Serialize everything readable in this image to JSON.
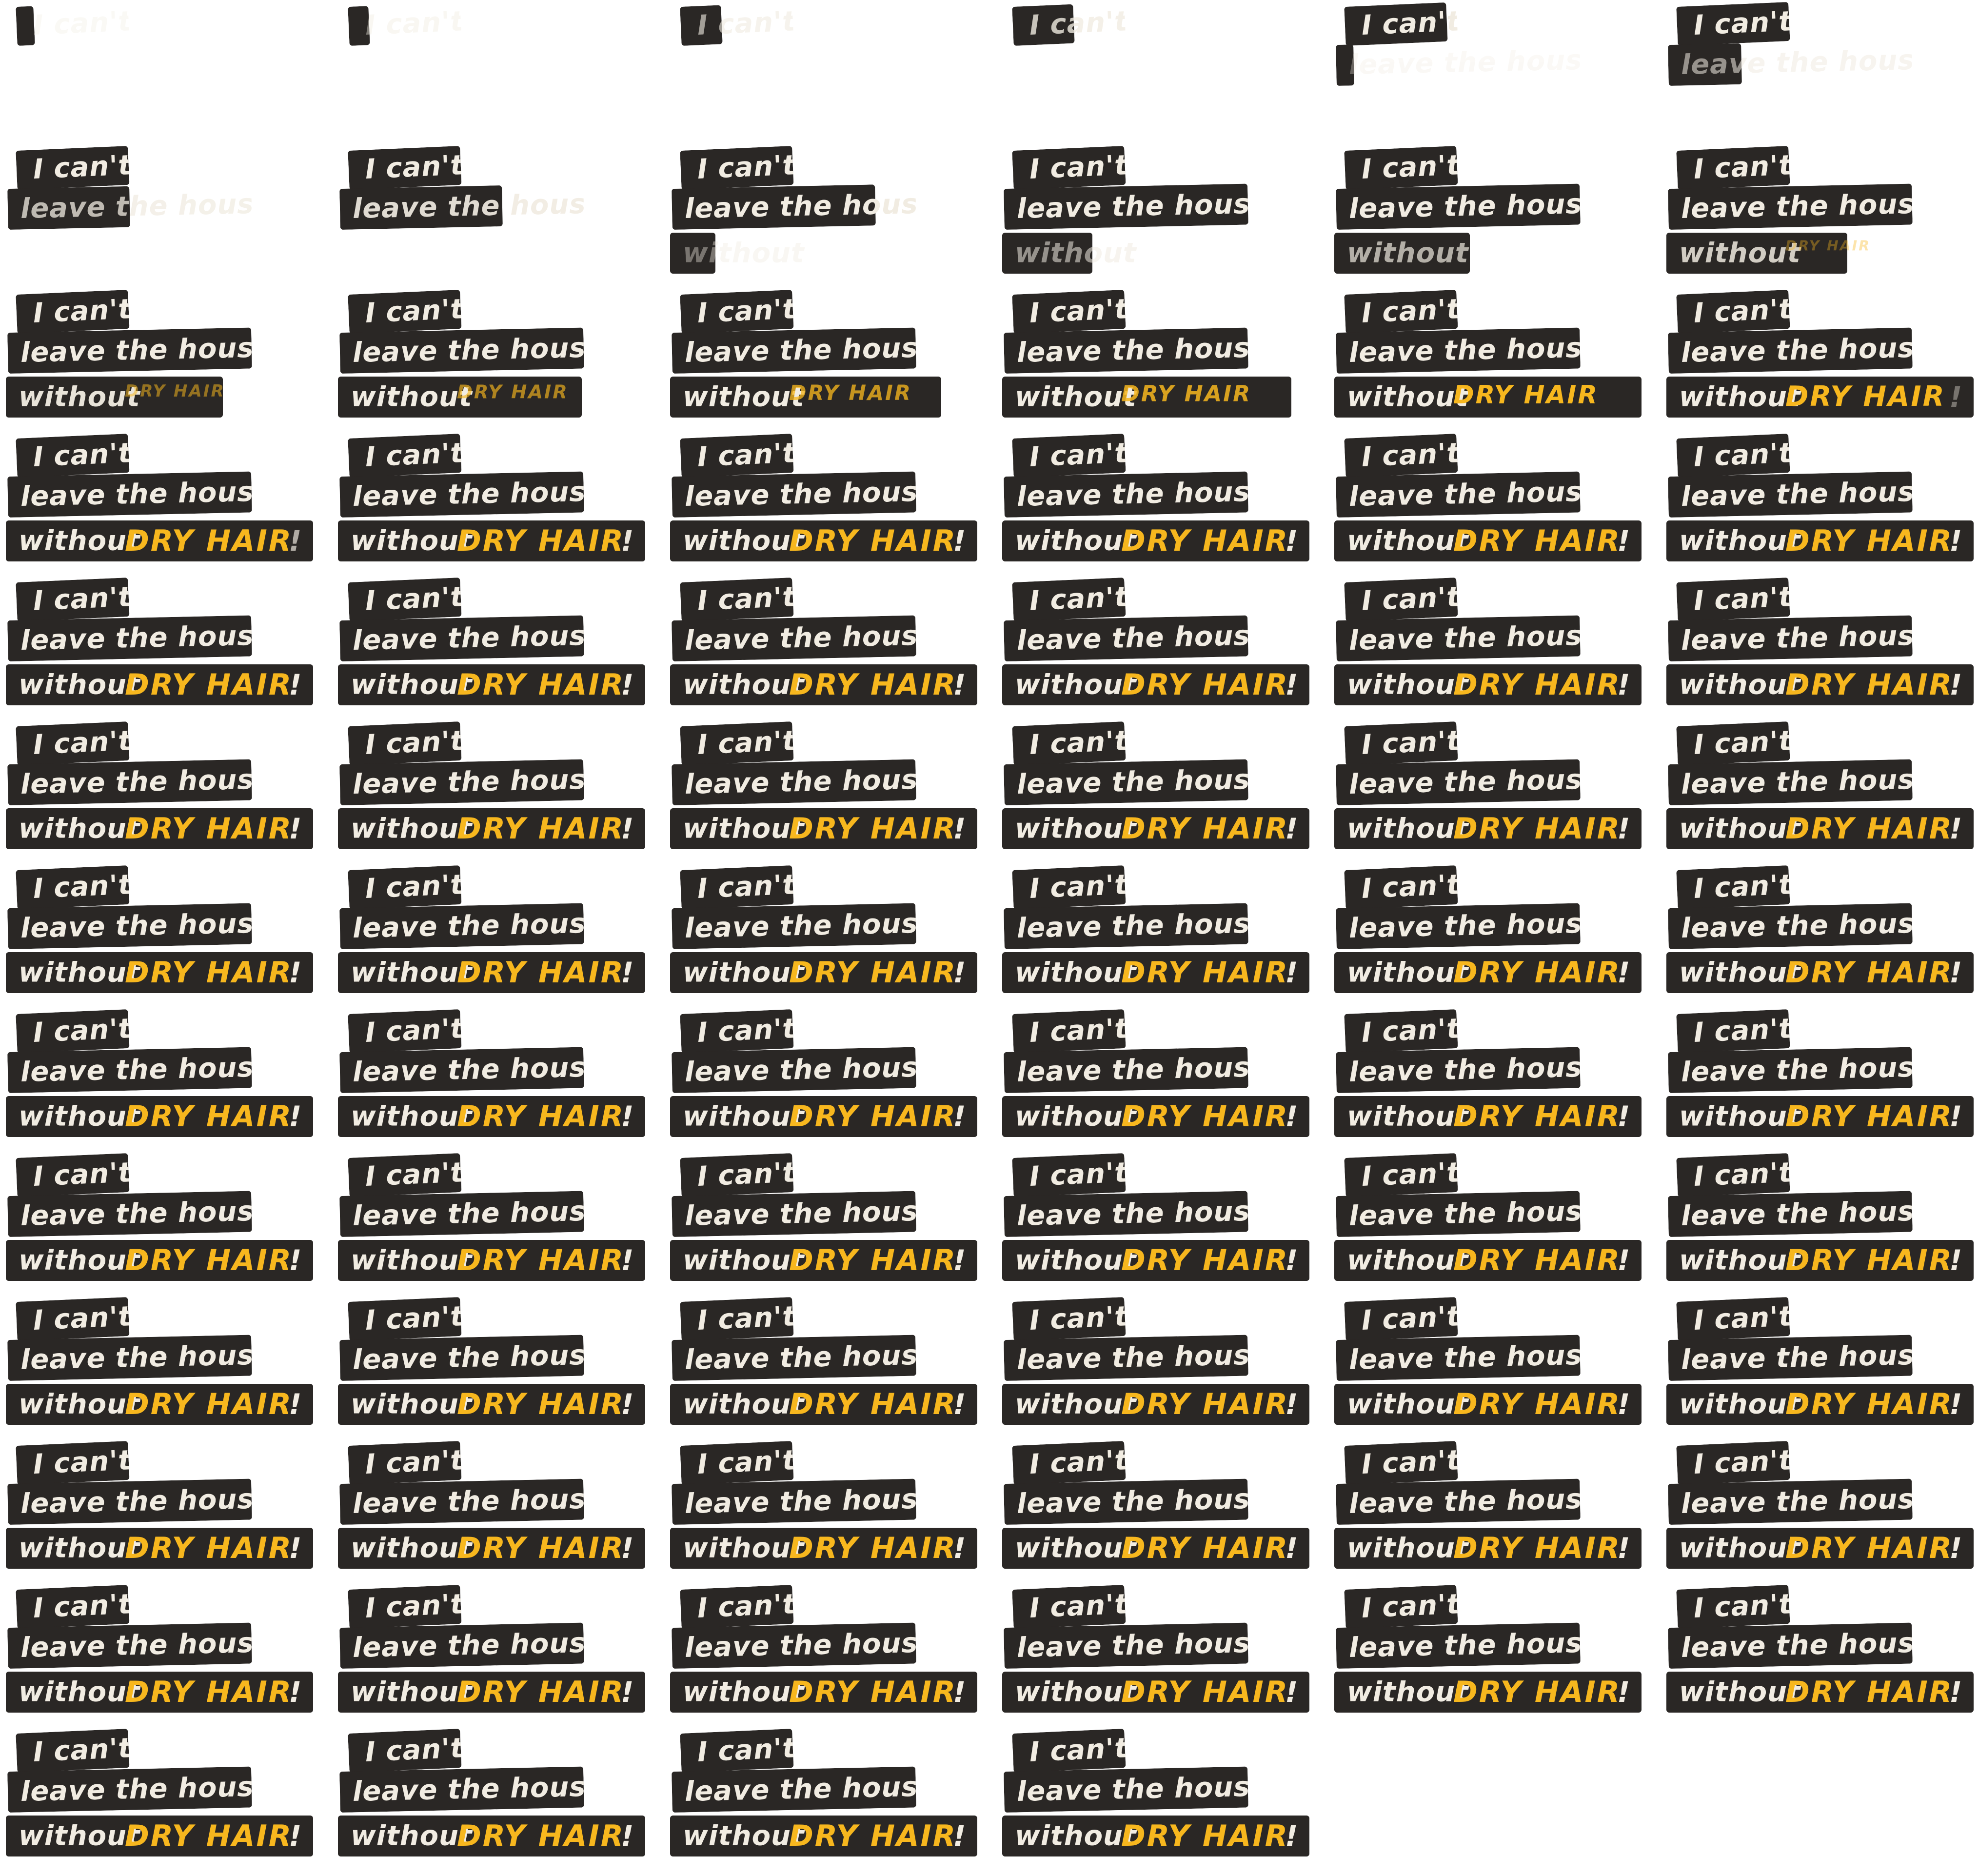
{
  "colors": {
    "box": "#2a2725",
    "light": "#f1ece2",
    "accent": "#f7b71e",
    "ghost": "#e8e1d4",
    "background": "#ffffff"
  },
  "text": {
    "line1": "I can't",
    "line2a": "leave the house",
    "line3a": "without",
    "line3b": "DRY HAIR",
    "line3c": "!"
  },
  "frames": [
    {
      "a": 0.02
    },
    {
      "a": 0.04
    },
    {
      "a": 0.08
    },
    {
      "a": 0.12
    },
    {
      "a": 0.2
    },
    {
      "a": 0.27
    },
    {
      "a": 0.33
    },
    {
      "a": 0.38
    },
    {
      "a": 0.43
    },
    {
      "a": 0.48
    },
    {
      "a": 0.53
    },
    {
      "a": 0.58
    },
    {
      "a": 0.62
    },
    {
      "a": 0.65
    },
    {
      "a": 0.68
    },
    {
      "a": 0.7
    },
    {
      "a": 0.74
    },
    {
      "a": 0.78
    },
    {
      "a": 0.82
    },
    {
      "a": 0.86
    },
    {
      "a": 0.9
    },
    {
      "a": 0.94
    },
    {
      "a": 0.98
    },
    {
      "a": 1.0
    },
    {
      "a": 1.0
    },
    {
      "a": 1.0
    },
    {
      "a": 1.0
    },
    {
      "a": 1.0
    },
    {
      "a": 1.0
    },
    {
      "a": 1.0
    },
    {
      "a": 1.0
    },
    {
      "a": 1.0
    },
    {
      "a": 1.0
    },
    {
      "a": 1.0
    },
    {
      "a": 1.0
    },
    {
      "a": 1.0
    },
    {
      "a": 1.0
    },
    {
      "a": 1.0
    },
    {
      "a": 1.0
    },
    {
      "a": 1.0
    },
    {
      "a": 1.0
    },
    {
      "a": 1.0
    },
    {
      "a": 1.0
    },
    {
      "a": 1.0
    },
    {
      "a": 1.0
    },
    {
      "a": 1.0
    },
    {
      "a": 1.0
    },
    {
      "a": 1.0
    },
    {
      "a": 1.0
    },
    {
      "a": 1.0
    },
    {
      "a": 1.0
    },
    {
      "a": 1.0
    },
    {
      "a": 1.0
    },
    {
      "a": 1.0
    },
    {
      "a": 1.0
    },
    {
      "a": 1.0
    },
    {
      "a": 1.0
    },
    {
      "a": 1.0
    },
    {
      "a": 1.0
    },
    {
      "a": 1.0
    },
    {
      "a": 1.0
    },
    {
      "a": 1.0
    },
    {
      "a": 1.0
    },
    {
      "a": 1.0
    },
    {
      "a": 1.0
    },
    {
      "a": 1.0
    },
    {
      "a": 1.0
    },
    {
      "a": 1.0
    },
    {
      "a": 1.0
    },
    {
      "a": 1.0
    },
    {
      "a": 1.0
    },
    {
      "a": 1.0
    },
    {
      "a": 1.0
    },
    {
      "a": 1.0
    },
    {
      "a": 1.0
    },
    {
      "a": 1.0
    }
  ]
}
